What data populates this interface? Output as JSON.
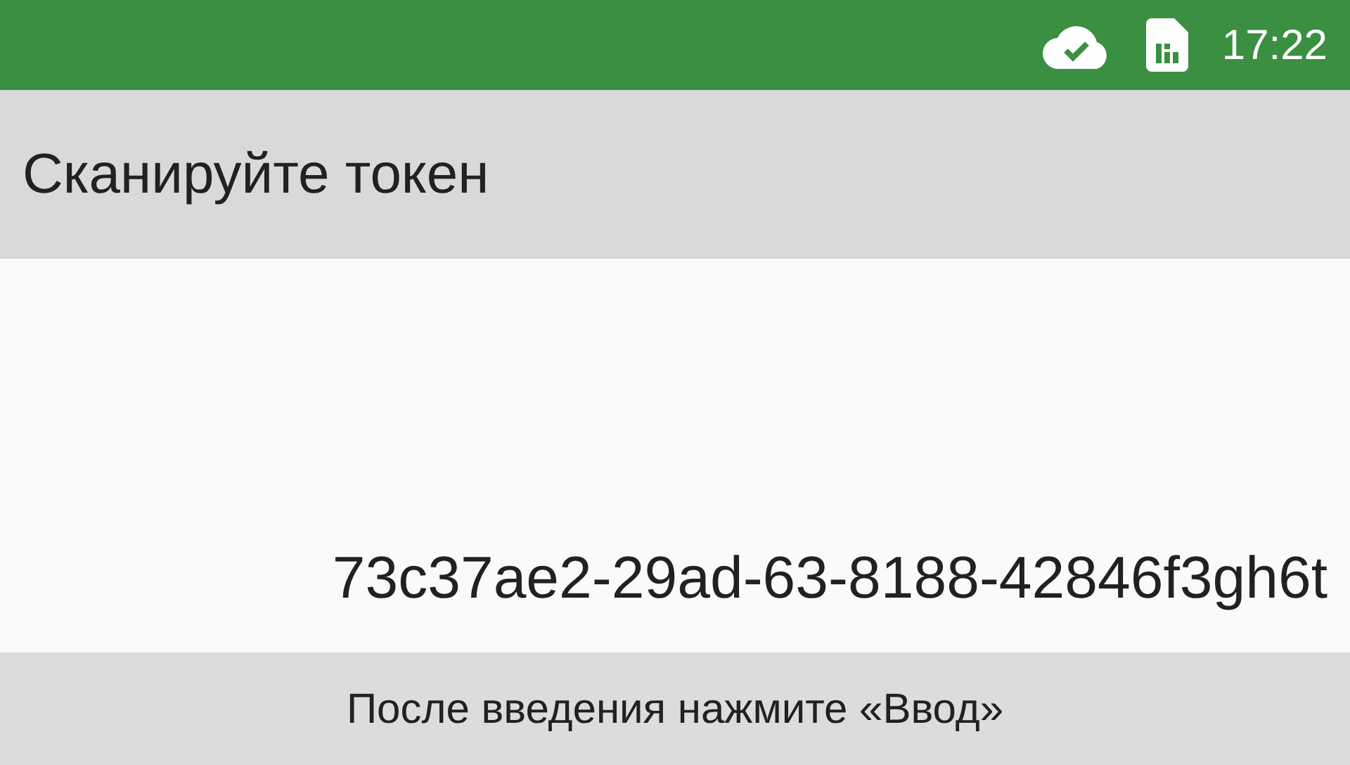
{
  "status_bar": {
    "cloud_synced": true,
    "time": "17:22"
  },
  "header": {
    "title": "Сканируйте токен"
  },
  "token": {
    "value": "73c37ae2-29ad-63-8188-42846f3gh6t"
  },
  "footer": {
    "hint": "После введения нажмите «Ввод»"
  }
}
